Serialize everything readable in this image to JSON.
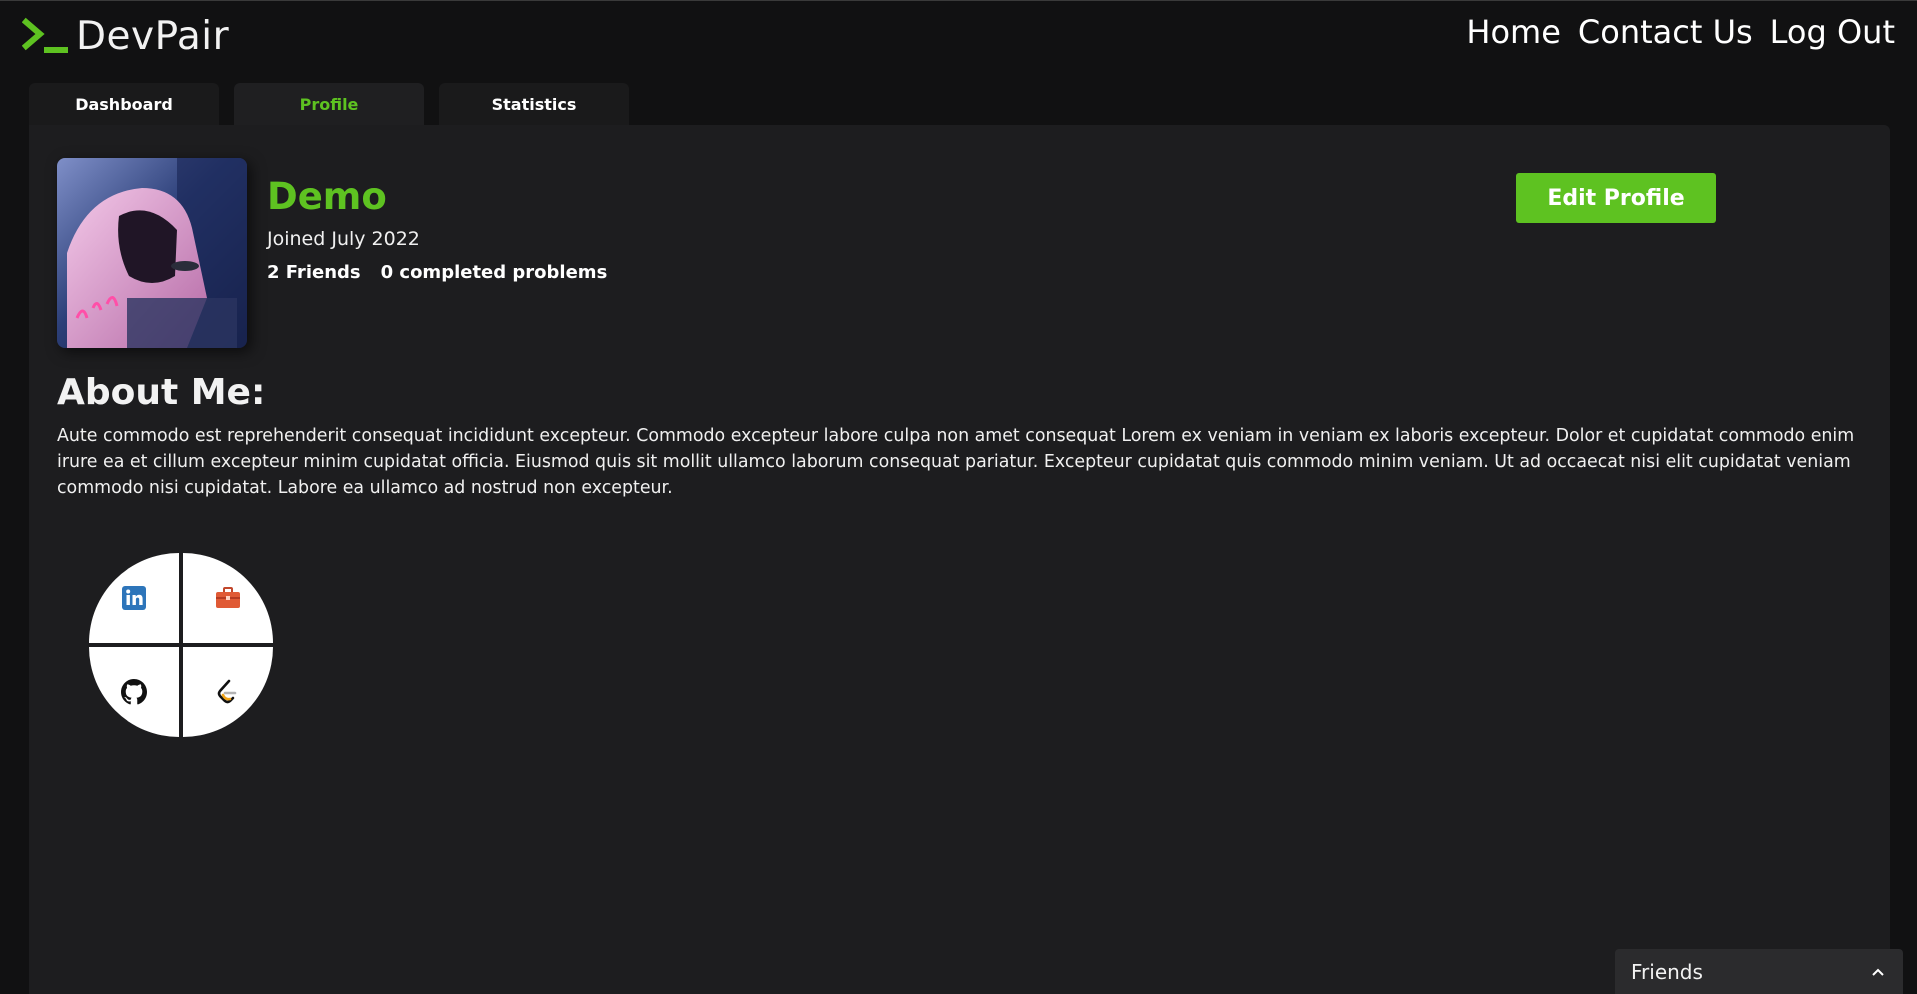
{
  "app": {
    "name": "DevPair",
    "accent": "#5ec221"
  },
  "nav": {
    "home": "Home",
    "contact": "Contact Us",
    "logout": "Log Out"
  },
  "tabs": [
    {
      "label": "Dashboard",
      "active": false
    },
    {
      "label": "Profile",
      "active": true
    },
    {
      "label": "Statistics",
      "active": false
    }
  ],
  "profile": {
    "username": "Demo",
    "joined": "Joined July 2022",
    "friends": "2 Friends",
    "completed": "0 completed problems",
    "edit_label": "Edit Profile",
    "about_title": "About Me:",
    "about_text": "Aute commodo est reprehenderit consequat incididunt excepteur. Commodo excepteur labore culpa non amet consequat Lorem ex veniam in veniam ex laboris excepteur. Dolor et cupidatat commodo enim irure ea et cillum excepteur minim cupidatat officia. Eiusmod quis sit mollit ullamco laborum consequat pariatur. Excepteur cupidatat quis commodo minim veniam. Ut ad occaecat nisi elit cupidatat veniam commodo nisi cupidatat. Labore ea ullamco ad nostrud non excepteur."
  },
  "social": [
    "linkedin-icon",
    "portfolio-icon",
    "github-icon",
    "leetcode-icon"
  ],
  "friends_panel": {
    "label": "Friends",
    "icon": "chevron-up-icon"
  }
}
